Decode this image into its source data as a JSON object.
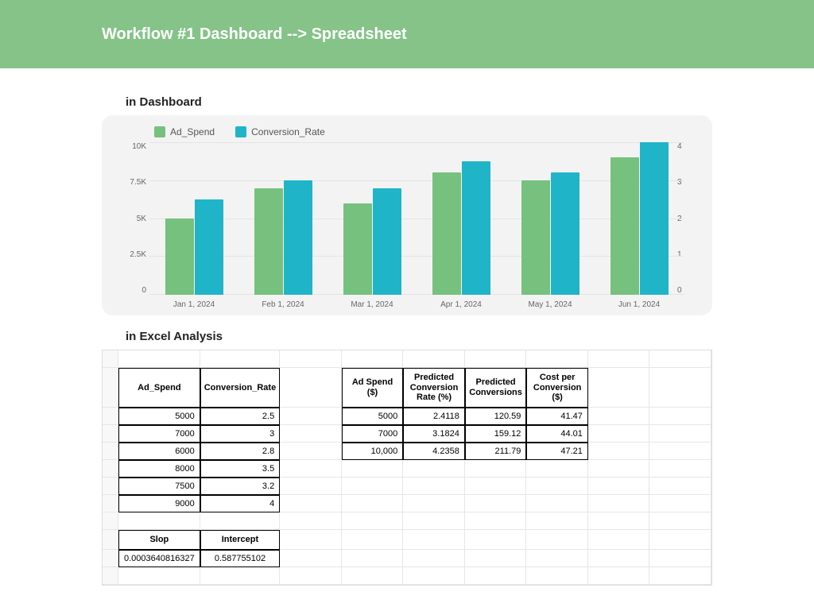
{
  "header": {
    "title": "Workflow #1 Dashboard --> Spreadsheet"
  },
  "sections": {
    "dashboard": "in Dashboard",
    "excel": "in Excel Analysis"
  },
  "legend": {
    "a": "Ad_Spend",
    "b": "Conversion_Rate"
  },
  "colors": {
    "adspend": "#76c17d",
    "conv": "#20b4c8",
    "header": "#85c388"
  },
  "chart_data": {
    "type": "bar",
    "categories": [
      "Jan 1, 2024",
      "Feb 1, 2024",
      "Mar 1, 2024",
      "Apr 1, 2024",
      "May 1, 2024",
      "Jun 1, 2024"
    ],
    "series": [
      {
        "name": "Ad_Spend",
        "values": [
          5000,
          7000,
          6000,
          8000,
          7500,
          9000
        ],
        "axis": "left"
      },
      {
        "name": "Conversion_Rate",
        "values": [
          2.5,
          3.0,
          2.8,
          3.5,
          3.2,
          4.0
        ],
        "axis": "right"
      }
    ],
    "yleft": {
      "ticks": [
        "10K",
        "7.5K",
        "5K",
        "2.5K",
        "0"
      ],
      "range": [
        0,
        10000
      ]
    },
    "yright": {
      "ticks": [
        "4",
        "3",
        "2",
        "1",
        "0"
      ],
      "range": [
        0,
        4
      ]
    },
    "title": "",
    "xlabel": "",
    "ylabel": ""
  },
  "excel": {
    "left": {
      "headers": [
        "Ad_Spend",
        "Conversion_Rate"
      ],
      "rows": [
        [
          "5000",
          "2.5"
        ],
        [
          "7000",
          "3"
        ],
        [
          "6000",
          "2.8"
        ],
        [
          "8000",
          "3.5"
        ],
        [
          "7500",
          "3.2"
        ],
        [
          "9000",
          "4"
        ]
      ],
      "stats_headers": [
        "Slop",
        "Intercept"
      ],
      "stats_values": [
        "0.0003640816327",
        "0.587755102"
      ]
    },
    "right": {
      "headers": [
        "Ad Spend ($)",
        "Predicted Conversion Rate (%)",
        "Predicted Conversions",
        "Cost per Conversion ($)"
      ],
      "rows": [
        [
          "5000",
          "2.4118",
          "120.59",
          "41.47"
        ],
        [
          "7000",
          "3.1824",
          "159.12",
          "44.01"
        ],
        [
          "10,000",
          "4.2358",
          "211.79",
          "47.21"
        ]
      ]
    }
  }
}
